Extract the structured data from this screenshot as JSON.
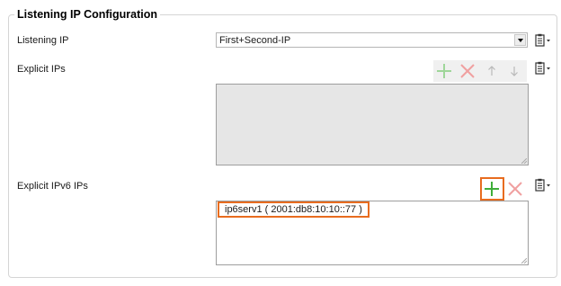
{
  "section": {
    "title": "Listening IP Configuration"
  },
  "listening_ip": {
    "label": "Listening IP",
    "selected": "First+Second-IP"
  },
  "explicit_ips": {
    "label": "Explicit IPs",
    "items": []
  },
  "explicit_ipv6_ips": {
    "label": "Explicit IPv6 IPs",
    "items": [
      "ip6serv1 ( 2001:db8:10:10::77 )"
    ]
  },
  "colors": {
    "accent_highlight": "#e86c1f",
    "add_green": "#3fae3a",
    "remove_red": "#e05a5a",
    "disabled_list_bg": "#e6e6e6"
  },
  "icons": {
    "add": "plus-icon",
    "remove": "x-icon",
    "move_up": "arrow-up-icon",
    "move_down": "arrow-down-icon",
    "clipboard": "clipboard-icon"
  }
}
